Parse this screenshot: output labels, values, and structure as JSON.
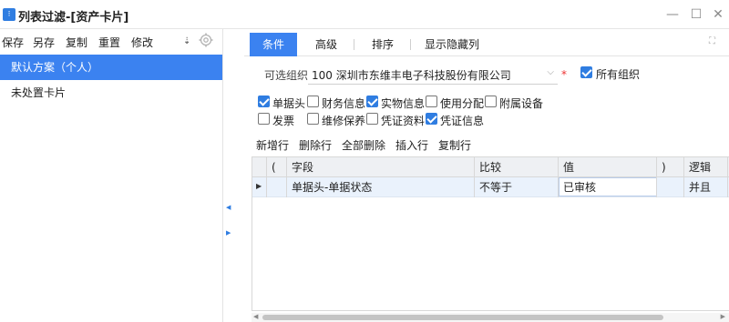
{
  "window": {
    "title": "列表过滤-[资产卡片]",
    "icon": "filter-app-icon",
    "controls": {
      "minimize": "—",
      "maximize": "☐",
      "close": "✕"
    }
  },
  "left_toolbar": {
    "save": "保存",
    "save_as": "另存",
    "copy": "复制",
    "reset": "重置",
    "modify": "修改",
    "sort_glyph": "⇣",
    "settings_icon": "gear-icon"
  },
  "schemes": [
    {
      "label": "默认方案（个人）",
      "active": true
    },
    {
      "label": "未处置卡片",
      "active": false
    }
  ],
  "divider_arrows": {
    "left": "◀",
    "right": "▶"
  },
  "tabs": [
    {
      "label": "条件",
      "active": true
    },
    {
      "label": "高级",
      "active": false
    },
    {
      "label": "排序",
      "active": false
    },
    {
      "label": "显示隐藏列",
      "active": false
    }
  ],
  "expand_glyph": "⛶",
  "org": {
    "label": "可选组织",
    "value": "100 深圳市东维丰电子科技股份有限公司",
    "required_mark": "*",
    "all_orgs_label": "所有组织",
    "all_orgs_checked": true
  },
  "categories": [
    {
      "label": "单据头",
      "checked": true
    },
    {
      "label": "财务信息",
      "checked": false
    },
    {
      "label": "实物信息",
      "checked": true
    },
    {
      "label": "使用分配",
      "checked": false
    },
    {
      "label": "附属设备",
      "checked": false
    },
    {
      "label": "发票",
      "checked": false
    },
    {
      "label": "维修保养",
      "checked": false
    },
    {
      "label": "凭证资料",
      "checked": false
    },
    {
      "label": "凭证信息",
      "checked": true
    }
  ],
  "row_ops": {
    "add": "新增行",
    "delete": "删除行",
    "delete_all": "全部删除",
    "insert": "插入行",
    "copy": "复制行"
  },
  "grid": {
    "columns": [
      "(",
      "字段",
      "比较",
      "值",
      ")",
      "逻辑"
    ],
    "rows": [
      {
        "marker": "▶",
        "lparen": "",
        "field": "单据头-单据状态",
        "compare": "不等于",
        "value": "已审核",
        "rparen": "",
        "logic": "并且"
      }
    ]
  },
  "scrollbar": {
    "left": "◀",
    "right": "▶"
  },
  "colors": {
    "accent": "#3b82f0",
    "check_on": "#2f7de1",
    "header_bg": "#eef0f3",
    "selected_row": "#eaf2fc",
    "required": "#e33333"
  }
}
